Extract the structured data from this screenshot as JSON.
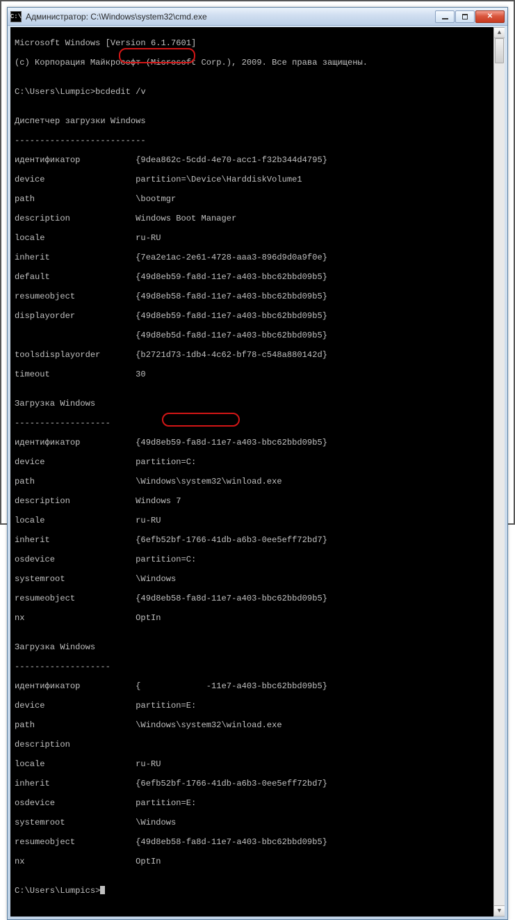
{
  "window": {
    "title": "Администратор: C:\\Windows\\system32\\cmd.exe",
    "icon_name": "cmd-icon",
    "buttons": {
      "min": "–",
      "max": "▢",
      "close": "✕"
    }
  },
  "scrollbar": {
    "up": "▲",
    "down": "▼"
  },
  "term": {
    "banner1": "Microsoft Windows [Version 6.1.7601]",
    "banner2": "(c) Корпорация Майкрософт (Microsoft Corp.), 2009. Все права защищены.",
    "blank": "",
    "prompt1": "C:\\Users\\Lumpic>",
    "command1": "bcdedit /v",
    "sec1_title": "Диспетчер загрузки Windows",
    "sec1_sep": "--------------------------",
    "s1": {
      "l1": "идентификатор           {9dea862c-5cdd-4e70-acc1-f32b344d4795}",
      "l2": "device                  partition=\\Device\\HarddiskVolume1",
      "l3": "path                    \\bootmgr",
      "l4": "description             Windows Boot Manager",
      "l5": "locale                  ru-RU",
      "l6": "inherit                 {7ea2e1ac-2e61-4728-aaa3-896d9d0a9f0e}",
      "l7": "default                 {49d8eb59-fa8d-11e7-a403-bbc62bbd09b5}",
      "l8": "resumeobject            {49d8eb58-fa8d-11e7-a403-bbc62bbd09b5}",
      "l9": "displayorder            {49d8eb59-fa8d-11e7-a403-bbc62bbd09b5}",
      "l10": "                        {49d8eb5d-fa8d-11e7-a403-bbc62bbd09b5}",
      "l11": "toolsdisplayorder       {b2721d73-1db4-4c62-bf78-c548a880142d}",
      "l12": "timeout                 30"
    },
    "sec2_title": "Загрузка Windows",
    "sec2_sep": "-------------------",
    "s2": {
      "l1": "идентификатор           {49d8eb59-fa8d-11e7-a403-bbc62bbd09b5}",
      "l2": "device                  partition=C:",
      "l3": "path                    \\Windows\\system32\\winload.exe",
      "l4": "description             Windows 7",
      "l5": "locale                  ru-RU",
      "l6": "inherit                 {6efb52bf-1766-41db-a6b3-0ee5eff72bd7}",
      "l7": "osdevice                partition=C:",
      "l8": "systemroot              \\Windows",
      "l9": "resumeobject            {49d8eb58-fa8d-11e7-a403-bbc62bbd09b5}",
      "l10": "nx                      OptIn"
    },
    "sec3_title": "Загрузка Windows",
    "sec3_sep": "-------------------",
    "s3": {
      "l1a": "идентификатор           {",
      "l1b": "-11e7-a403-bbc62bbd09b5}",
      "l2a": "device                  ",
      "l2h": "partition=E:",
      "l3": "path                    \\Windows\\system32\\winload.exe",
      "l4": "description",
      "l5": "locale                  ru-RU",
      "l6": "inherit                 {6efb52bf-1766-41db-a6b3-0ee5eff72bd7}",
      "l7": "osdevice                partition=E:",
      "l8": "systemroot              \\Windows",
      "l9": "resumeobject            {49d8eb58-fa8d-11e7-a403-bbc62bbd09b5}",
      "l10": "nx                      OptIn"
    },
    "prompt2": "C:\\Users\\Lumpics>"
  }
}
